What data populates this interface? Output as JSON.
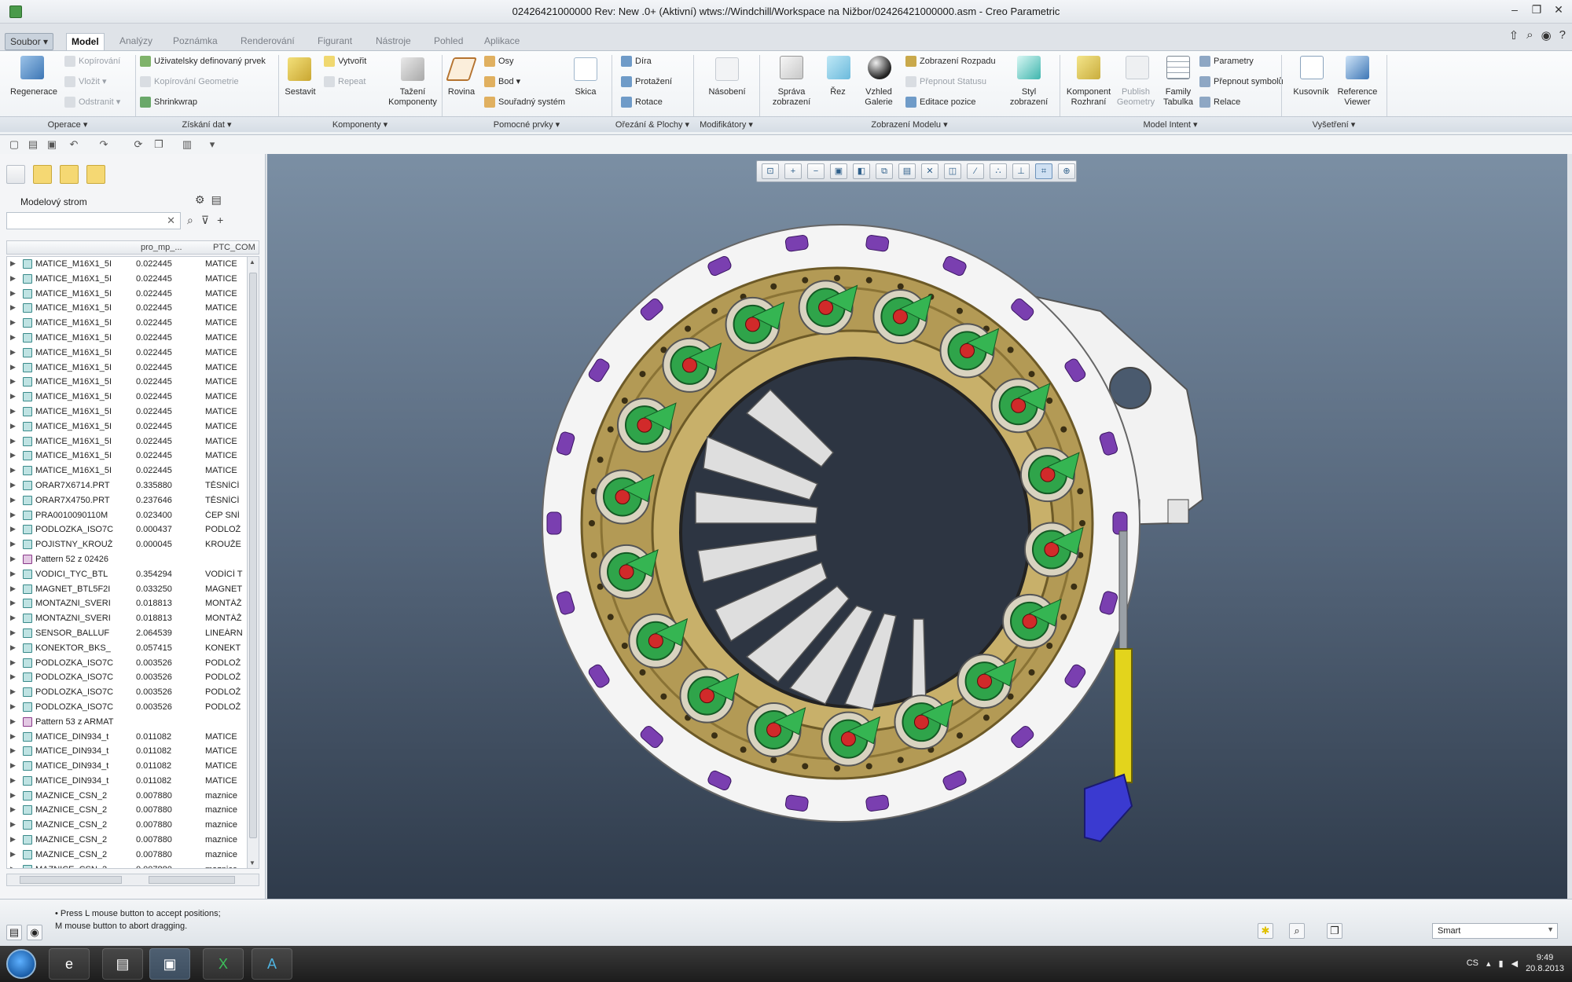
{
  "window": {
    "title": "02426421000000 Rev: New .0+  (Aktivní) wtws://Windchill/Workspace na Nižbor/02426421000000.asm - Creo Parametric"
  },
  "tabs": [
    {
      "label": "Soubor ▾",
      "kind": "file"
    },
    {
      "label": "Model",
      "kind": "active"
    },
    {
      "label": "Analýzy",
      "kind": ""
    },
    {
      "label": "Poznámka",
      "kind": ""
    },
    {
      "label": "Renderování",
      "kind": ""
    },
    {
      "label": "Figurant",
      "kind": ""
    },
    {
      "label": "Nástroje",
      "kind": ""
    },
    {
      "label": "Pohled",
      "kind": ""
    },
    {
      "label": "Aplikace",
      "kind": ""
    }
  ],
  "ribbon": {
    "regenerace": "Regenerace",
    "kopirovani": "Kopírování",
    "vlozit": "Vložit",
    "odstranit": "Odstranit",
    "uzivatelsky": "Uživatelsky definovaný prvek",
    "kopirovani_geometrie": "Kopírování Geometrie",
    "shrinkwrap": "Shrinkwrap",
    "sestavit": "Sestavit",
    "vytvorit": "Vytvořit",
    "repeat": "Repeat",
    "tazeni_komponenty": "Tažení Komponenty",
    "rovina": "Rovina",
    "osy": "Osy",
    "bod": "Bod",
    "souradny_system": "Souřadný systém",
    "skica": "Skica",
    "dira": "Díra",
    "protazeni": "Protažení",
    "rotace": "Rotace",
    "nasobeni": "Násobení",
    "sprava_zobrazeni": "Správa zobrazení",
    "rez": "Řez",
    "vzhled_galerie": "Vzhled Galerie",
    "zobrazeni_rozpadu": "Zobrazení Rozpadu",
    "prepnout_statusu": "Přepnout Statusu",
    "editace_pozice": "Editace pozice",
    "styl_zobrazeni": "Styl zobrazení",
    "komponent_rozhrani": "Komponent Rozhraní",
    "publish_geometry": "Publish Geometry",
    "family_tabulka": "Family Tabulka",
    "parametry": "Parametry",
    "prepnout_symbolu": "Přepnout symbolů",
    "relace": "Relace",
    "kusovnik": "Kusovník",
    "reference_viewer": "Reference Viewer"
  },
  "groups": [
    {
      "label": "Operace ▾"
    },
    {
      "label": "Získání dat ▾"
    },
    {
      "label": "Komponenty ▾"
    },
    {
      "label": "Pomocné prvky ▾"
    },
    {
      "label": "Ořezání & Plochy ▾"
    },
    {
      "label": "Modifikátory ▾"
    },
    {
      "label": "Zobrazení Modelu ▾"
    },
    {
      "label": "Model Intent ▾"
    },
    {
      "label": "Vyšetření ▾"
    }
  ],
  "tree": {
    "title": "Modelový strom",
    "col_mp": "pro_mp_...",
    "col_ptc": "PTC_COM",
    "rows": [
      {
        "name": "MATICE_M16X1_5I",
        "mp": "0.022445",
        "pc": "MATICE",
        "t": "p"
      },
      {
        "name": "MATICE_M16X1_5I",
        "mp": "0.022445",
        "pc": "MATICE",
        "t": "p"
      },
      {
        "name": "MATICE_M16X1_5I",
        "mp": "0.022445",
        "pc": "MATICE",
        "t": "p"
      },
      {
        "name": "MATICE_M16X1_5I",
        "mp": "0.022445",
        "pc": "MATICE",
        "t": "p"
      },
      {
        "name": "MATICE_M16X1_5I",
        "mp": "0.022445",
        "pc": "MATICE",
        "t": "p"
      },
      {
        "name": "MATICE_M16X1_5I",
        "mp": "0.022445",
        "pc": "MATICE",
        "t": "p"
      },
      {
        "name": "MATICE_M16X1_5I",
        "mp": "0.022445",
        "pc": "MATICE",
        "t": "p"
      },
      {
        "name": "MATICE_M16X1_5I",
        "mp": "0.022445",
        "pc": "MATICE",
        "t": "p"
      },
      {
        "name": "MATICE_M16X1_5I",
        "mp": "0.022445",
        "pc": "MATICE",
        "t": "p"
      },
      {
        "name": "MATICE_M16X1_5I",
        "mp": "0.022445",
        "pc": "MATICE",
        "t": "p"
      },
      {
        "name": "MATICE_M16X1_5I",
        "mp": "0.022445",
        "pc": "MATICE",
        "t": "p"
      },
      {
        "name": "MATICE_M16X1_5I",
        "mp": "0.022445",
        "pc": "MATICE",
        "t": "p"
      },
      {
        "name": "MATICE_M16X1_5I",
        "mp": "0.022445",
        "pc": "MATICE",
        "t": "p"
      },
      {
        "name": "MATICE_M16X1_5I",
        "mp": "0.022445",
        "pc": "MATICE",
        "t": "p"
      },
      {
        "name": "MATICE_M16X1_5I",
        "mp": "0.022445",
        "pc": "MATICE",
        "t": "p"
      },
      {
        "name": "ORAR7X6714.PRT",
        "mp": "0.335880",
        "pc": "TĚSNÍCÍ",
        "t": "p"
      },
      {
        "name": "ORAR7X4750.PRT",
        "mp": "0.237646",
        "pc": "TĚSNÍCÍ",
        "t": "p"
      },
      {
        "name": "PRA0010090110M",
        "mp": "0.023400",
        "pc": "ČEP SNÍ",
        "t": "p"
      },
      {
        "name": "PODLOZKA_ISO7C",
        "mp": "0.000437",
        "pc": "PODLOŽ",
        "t": "p"
      },
      {
        "name": "POJISTNY_KROUŽ",
        "mp": "0.000045",
        "pc": "KROUŽE",
        "t": "p"
      },
      {
        "name": "Pattern 52 z 02426",
        "mp": "",
        "pc": "",
        "t": "pat"
      },
      {
        "name": "VODICI_TYC_BTL",
        "mp": "0.354294",
        "pc": "VODÍCÍ T",
        "t": "p"
      },
      {
        "name": "MAGNET_BTL5F2I",
        "mp": "0.033250",
        "pc": "MAGNET",
        "t": "p"
      },
      {
        "name": "MONTAZNI_SVERI",
        "mp": "0.018813",
        "pc": "MONTÁŽ",
        "t": "p"
      },
      {
        "name": "MONTAZNI_SVERI",
        "mp": "0.018813",
        "pc": "MONTÁŽ",
        "t": "p"
      },
      {
        "name": "SENSOR_BALLUF",
        "mp": "2.064539",
        "pc": "LINEÁRN",
        "t": "p"
      },
      {
        "name": "KONEKTOR_BKS_",
        "mp": "0.057415",
        "pc": "KONEKT",
        "t": "p"
      },
      {
        "name": "PODLOZKA_ISO7C",
        "mp": "0.003526",
        "pc": "PODLOŽ",
        "t": "p"
      },
      {
        "name": "PODLOZKA_ISO7C",
        "mp": "0.003526",
        "pc": "PODLOŽ",
        "t": "p"
      },
      {
        "name": "PODLOZKA_ISO7C",
        "mp": "0.003526",
        "pc": "PODLOŽ",
        "t": "p"
      },
      {
        "name": "PODLOZKA_ISO7C",
        "mp": "0.003526",
        "pc": "PODLOŽ",
        "t": "p"
      },
      {
        "name": "Pattern 53 z ARMAT",
        "mp": "",
        "pc": "",
        "t": "pat"
      },
      {
        "name": "MATICE_DIN934_t",
        "mp": "0.011082",
        "pc": "MATICE",
        "t": "p"
      },
      {
        "name": "MATICE_DIN934_t",
        "mp": "0.011082",
        "pc": "MATICE",
        "t": "p"
      },
      {
        "name": "MATICE_DIN934_t",
        "mp": "0.011082",
        "pc": "MATICE",
        "t": "p"
      },
      {
        "name": "MATICE_DIN934_t",
        "mp": "0.011082",
        "pc": "MATICE",
        "t": "p"
      },
      {
        "name": "MAZNICE_CSN_2",
        "mp": "0.007880",
        "pc": "maznice",
        "t": "p"
      },
      {
        "name": "MAZNICE_CSN_2",
        "mp": "0.007880",
        "pc": "maznice",
        "t": "p"
      },
      {
        "name": "MAZNICE_CSN_2",
        "mp": "0.007880",
        "pc": "maznice",
        "t": "p"
      },
      {
        "name": "MAZNICE_CSN_2",
        "mp": "0.007880",
        "pc": "maznice",
        "t": "p"
      },
      {
        "name": "MAZNICE_CSN_2",
        "mp": "0.007880",
        "pc": "maznice",
        "t": "p"
      },
      {
        "name": "MAZNICE_CSN_2",
        "mp": "0.007880",
        "pc": "maznice",
        "t": "p"
      }
    ]
  },
  "status": {
    "line1": "• Press L mouse button to accept positions;",
    "line2": "M mouse button to abort dragging.",
    "filter": "Smart"
  },
  "tray": {
    "lang": "CS",
    "time": "9:49",
    "date": "20.8.2013"
  },
  "colors": {
    "ring_gold": "#b39a55",
    "ring_white": "#f4f4f4",
    "actuator_green": "#2fa44a",
    "clamp_purple": "#7a3fb0",
    "cylinder_yellow": "#e3d41c"
  }
}
